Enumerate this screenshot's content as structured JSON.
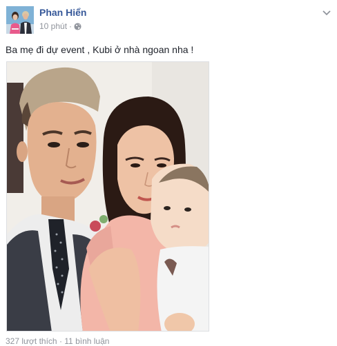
{
  "post": {
    "author": "Phan Hiển",
    "timestamp": "10 phút",
    "separator": "·",
    "privacy_icon": "globe-icon",
    "menu_icon": "chevron-down-icon",
    "text": "Ba mẹ đi dự event , Kubi ở nhà ngoan nha !",
    "photo": {
      "subject": "photo",
      "people": [
        "man-in-vest",
        "woman",
        "baby"
      ]
    },
    "footer_text": "327 lượt thích · 11 bình luận"
  },
  "colors": {
    "link": "#365899",
    "meta": "#90949c",
    "text": "#1d2129",
    "border": "#dddfe2"
  }
}
